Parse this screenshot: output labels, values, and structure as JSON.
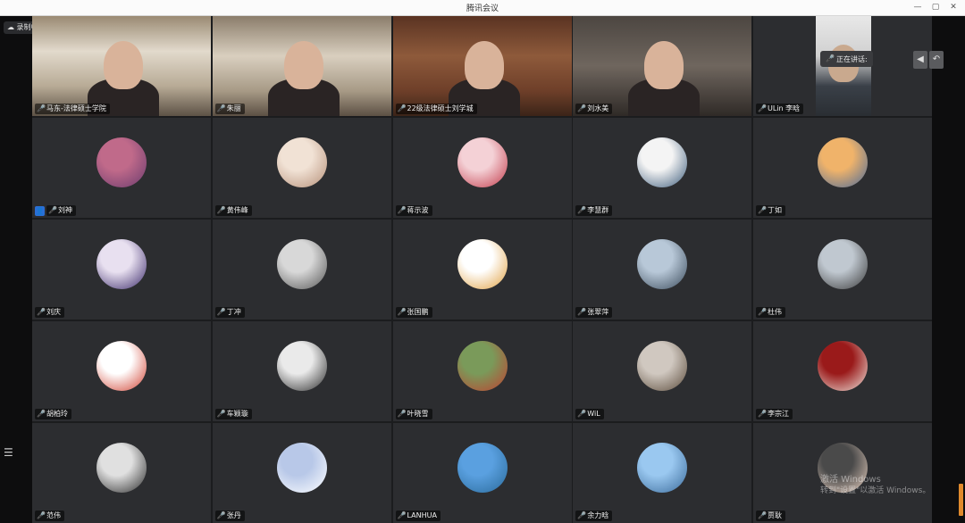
{
  "window": {
    "title": "腾讯会议",
    "controls": {
      "minimize": "—",
      "maximize": "▢",
      "close": "✕"
    }
  },
  "left_toolbar": {
    "cloud_label": "录制中",
    "menu_icon": "☰"
  },
  "speaking_indicator": {
    "label": "正在讲话:"
  },
  "pager": {
    "prev": "◀",
    "back": "↶"
  },
  "watermark": {
    "line1": "激活 Windows",
    "line2": "转到\"设置\"以激活 Windows。"
  },
  "participants": [
    {
      "name": "马东-法律硕士学院",
      "kind": "video",
      "style": "v1"
    },
    {
      "name": "朱丽",
      "kind": "video",
      "style": "v2"
    },
    {
      "name": "22级法律硕士刘学城",
      "kind": "video",
      "style": "v3"
    },
    {
      "name": "刘水美",
      "kind": "video",
      "style": "v4"
    },
    {
      "name": "ULin 李晗",
      "kind": "video",
      "style": "v5"
    },
    {
      "name": "刘神",
      "kind": "avatar",
      "colors": [
        "#c06a8a",
        "#6a3b6e"
      ]
    },
    {
      "name": "黄伟峰",
      "kind": "avatar",
      "colors": [
        "#f1e2d5",
        "#b58f78"
      ]
    },
    {
      "name": "蒋示波",
      "kind": "avatar",
      "colors": [
        "#f4d1d6",
        "#c23a4a"
      ]
    },
    {
      "name": "李慧群",
      "kind": "avatar",
      "colors": [
        "#f4f4f4",
        "#3b5a7a"
      ]
    },
    {
      "name": "丁如",
      "kind": "avatar",
      "colors": [
        "#f0b36a",
        "#4a6a9a"
      ]
    },
    {
      "name": "刘庆",
      "kind": "avatar",
      "colors": [
        "#e8e0f0",
        "#3b2a6a"
      ]
    },
    {
      "name": "丁冲",
      "kind": "avatar",
      "colors": [
        "#d8d8d8",
        "#555555"
      ]
    },
    {
      "name": "张国鹏",
      "kind": "avatar",
      "colors": [
        "#ffffff",
        "#e0a040"
      ]
    },
    {
      "name": "张翠萍",
      "kind": "avatar",
      "colors": [
        "#b8c8d8",
        "#3a4a5a"
      ]
    },
    {
      "name": "杜伟",
      "kind": "avatar",
      "colors": [
        "#c0c8d0",
        "#3a3a3a"
      ]
    },
    {
      "name": "胡柏玲",
      "kind": "avatar",
      "colors": [
        "#ffffff",
        "#d04030"
      ]
    },
    {
      "name": "车颖璇",
      "kind": "avatar",
      "colors": [
        "#eaeaea",
        "#2a2a2a"
      ]
    },
    {
      "name": "叶晓雪",
      "kind": "avatar",
      "colors": [
        "#7a9a5a",
        "#c04030"
      ]
    },
    {
      "name": "WiL",
      "kind": "avatar",
      "colors": [
        "#d0c8c0",
        "#5a4a3a"
      ]
    },
    {
      "name": "李宗江",
      "kind": "avatar",
      "colors": [
        "#9a1a1a",
        "#f0e8e0"
      ]
    },
    {
      "name": "范伟",
      "kind": "avatar",
      "colors": [
        "#e0e0e0",
        "#2a2a2a"
      ]
    },
    {
      "name": "张丹",
      "kind": "avatar",
      "colors": [
        "#b8c8e8",
        "#ffffff"
      ]
    },
    {
      "name": "LANHUA",
      "kind": "avatar",
      "colors": [
        "#5aa0e0",
        "#2a6a9a"
      ]
    },
    {
      "name": "余力晗",
      "kind": "avatar",
      "colors": [
        "#9ac8f0",
        "#3a6a9a"
      ]
    },
    {
      "name": "贾耿",
      "kind": "avatar",
      "colors": [
        "#4a4a4a",
        "#e8d0c0"
      ]
    }
  ]
}
